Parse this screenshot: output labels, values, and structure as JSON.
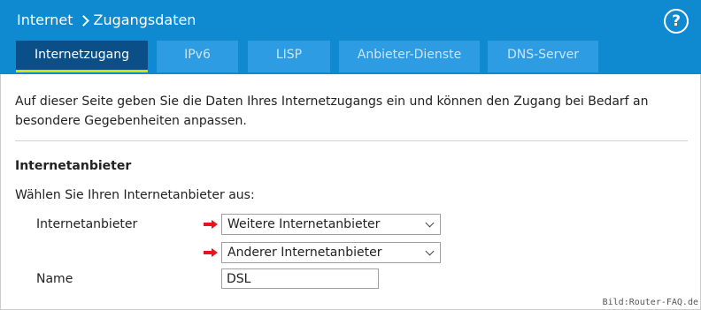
{
  "breadcrumb": {
    "section": "Internet",
    "page": "Zugangsdaten"
  },
  "help": {
    "label": "?"
  },
  "tabs": [
    {
      "label": "Internetzugang",
      "active": true
    },
    {
      "label": "IPv6",
      "active": false
    },
    {
      "label": "LISP",
      "active": false
    },
    {
      "label": "Anbieter-Dienste",
      "active": false
    },
    {
      "label": "DNS-Server",
      "active": false
    }
  ],
  "intro": "Auf dieser Seite geben Sie die Daten Ihres Internetzugangs ein und können den Zugang bei Bedarf an besondere Gegebenheiten anpassen.",
  "section_title": "Internetanbieter",
  "prompt": "Wählen Sie Ihren Internetanbieter aus:",
  "provider": {
    "label": "Internetanbieter",
    "select1_value": "Weitere Internetanbieter",
    "select2_value": "Anderer Internetanbieter"
  },
  "name": {
    "label": "Name",
    "value": "DSL"
  },
  "watermark": "Bild:Router-FAQ.de",
  "colors": {
    "header": "#0f89d0",
    "tab_active": "#0a4f87",
    "tab_inactive": "#2e9ce3",
    "tab_underline": "#d6e100",
    "arrow": "#e8141c"
  }
}
